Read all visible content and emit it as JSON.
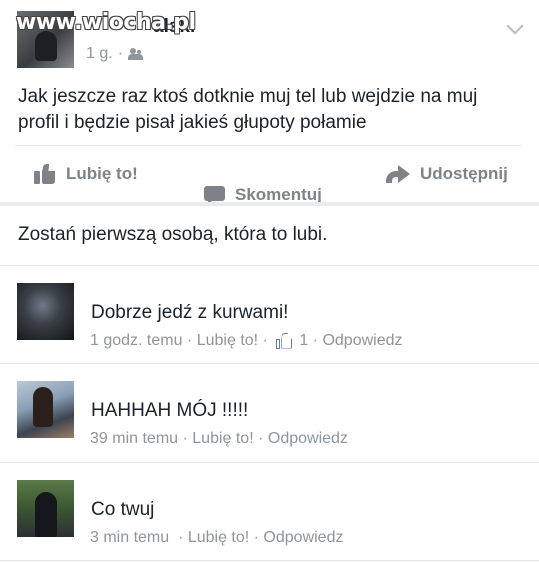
{
  "watermark": "www.wiocha.pl",
  "post": {
    "author": "alski",
    "time": "1 g.",
    "separator": "·",
    "text": "Jak jeszcze raz ktoś dotknie muj tel lub wejdzie na muj profil i będzie pisał jakieś głupoty połamie"
  },
  "actions": {
    "like": "Lubię to!",
    "comment": "Skomentuj",
    "share": "Udostępnij"
  },
  "likes_summary": "Zostań pierwszą osobą, która to lubi.",
  "comments": [
    {
      "text": "Dobrze jedź z kurwami!",
      "time": "1 godz. temu",
      "sep1": " · ",
      "like": "Lubię to!",
      "sep2": " · ",
      "like_count": "1",
      "sep3": " · ",
      "reply": "Odpowiedz"
    },
    {
      "text": "HAHHAH MÓJ !!!!!",
      "time": "39 min temu",
      "sep1": " · ",
      "like": "Lubię to!",
      "sep2": " · ",
      "reply": "Odpowiedz"
    },
    {
      "text": "Co twuj",
      "time": "3 min temu",
      "sep1": "  · ",
      "like": "Lubię to!",
      "sep2": " · ",
      "reply": "Odpowiedz"
    }
  ]
}
